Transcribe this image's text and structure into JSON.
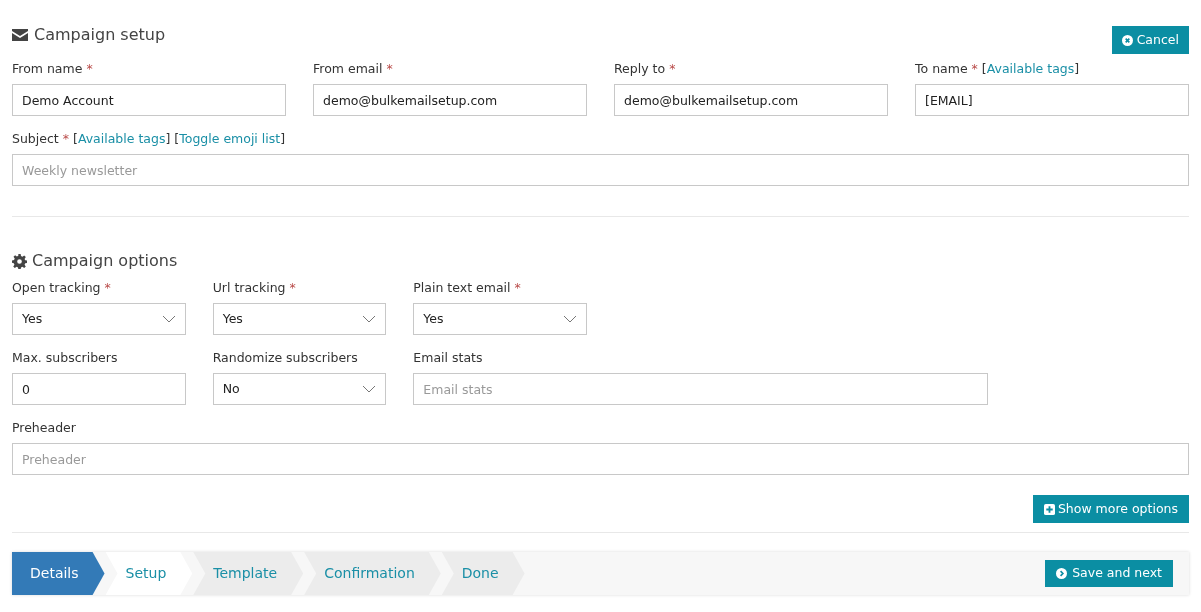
{
  "setup": {
    "title": "Campaign setup",
    "cancel": "Cancel",
    "rows": [
      [
        {
          "label": "From name",
          "required_mark": "*",
          "kind": "input",
          "value": "Demo Account"
        },
        {
          "label": "From email",
          "required_mark": "*",
          "kind": "input",
          "value": "demo@bulkemailsetup.com"
        },
        {
          "label": "Reply to",
          "required_mark": "*",
          "kind": "input",
          "value": "demo@bulkemailsetup.com"
        },
        {
          "label": "To name",
          "required_mark": "*",
          "links": [
            {
              "open": "[",
              "text": "Available tags",
              "close": "]"
            }
          ],
          "kind": "input",
          "value": "[EMAIL]"
        }
      ],
      [
        {
          "label": "Subject",
          "required_mark": "*",
          "links": [
            {
              "open": "[",
              "text": "Available tags",
              "close": "]"
            },
            {
              "open": "[",
              "text": "Toggle emoji list",
              "close": "]"
            }
          ],
          "kind": "input",
          "placeholder": "Weekly newsletter"
        }
      ]
    ]
  },
  "options": {
    "title": "Campaign options",
    "rows": [
      [
        {
          "label": "Open tracking",
          "required_mark": "*",
          "kind": "select",
          "value": "Yes"
        },
        {
          "label": "Url tracking",
          "required_mark": "*",
          "kind": "select",
          "value": "Yes"
        },
        {
          "label": "Plain text email",
          "required_mark": "*",
          "kind": "select",
          "value": "Yes"
        }
      ],
      [
        {
          "label": "Max. subscribers",
          "kind": "input",
          "value": "0"
        },
        {
          "label": "Randomize subscribers",
          "kind": "select",
          "value": "No"
        },
        {
          "label": "Email stats",
          "kind": "input",
          "placeholder": "Email stats"
        }
      ],
      [
        {
          "label": "Preheader",
          "kind": "input",
          "placeholder": "Preheader"
        }
      ]
    ],
    "more": "Show more options"
  },
  "wizard": {
    "steps": [
      {
        "label": "Details",
        "selected": true,
        "disabled": false
      },
      {
        "label": "Setup",
        "selected": false,
        "disabled": false
      },
      {
        "label": "Template",
        "selected": false,
        "disabled": true
      },
      {
        "label": "Confirmation",
        "selected": false,
        "disabled": true
      },
      {
        "label": "Done",
        "selected": false,
        "disabled": true
      }
    ],
    "next": "Save and next"
  }
}
